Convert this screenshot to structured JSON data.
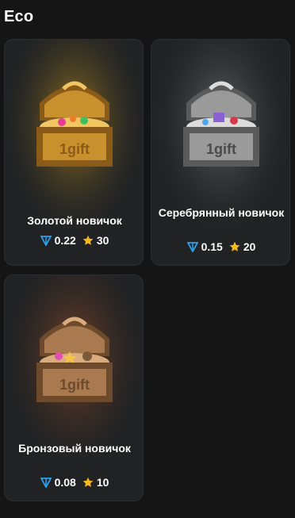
{
  "section": {
    "title": "Eco"
  },
  "cards": [
    {
      "title": "Золотой новичок",
      "ton": "0.22",
      "stars": "30",
      "chest_label": "1gift",
      "variant": "gold",
      "colors": {
        "glow": "#c8961f",
        "body": "#c9902e",
        "dark": "#8a5a18",
        "light": "#f2c563"
      }
    },
    {
      "title": "Серебрянный новичок",
      "ton": "0.15",
      "stars": "20",
      "chest_label": "1gift",
      "variant": "silver",
      "colors": {
        "glow": "#7a7a7a",
        "body": "#9a9a9a",
        "dark": "#5a5a5a",
        "light": "#dcdcdc"
      }
    },
    {
      "title": "Бронзовый новичок",
      "ton": "0.08",
      "stars": "10",
      "chest_label": "1gift",
      "variant": "bronze",
      "colors": {
        "glow": "#a9542a",
        "body": "#a9794f",
        "dark": "#6e4a2c",
        "light": "#d9ac7d"
      }
    }
  ],
  "icons": {
    "ton": "ton-diamond-icon",
    "star": "star-icon"
  },
  "accent": {
    "ton": "#2aa3ef",
    "star": "#f6b81b"
  }
}
